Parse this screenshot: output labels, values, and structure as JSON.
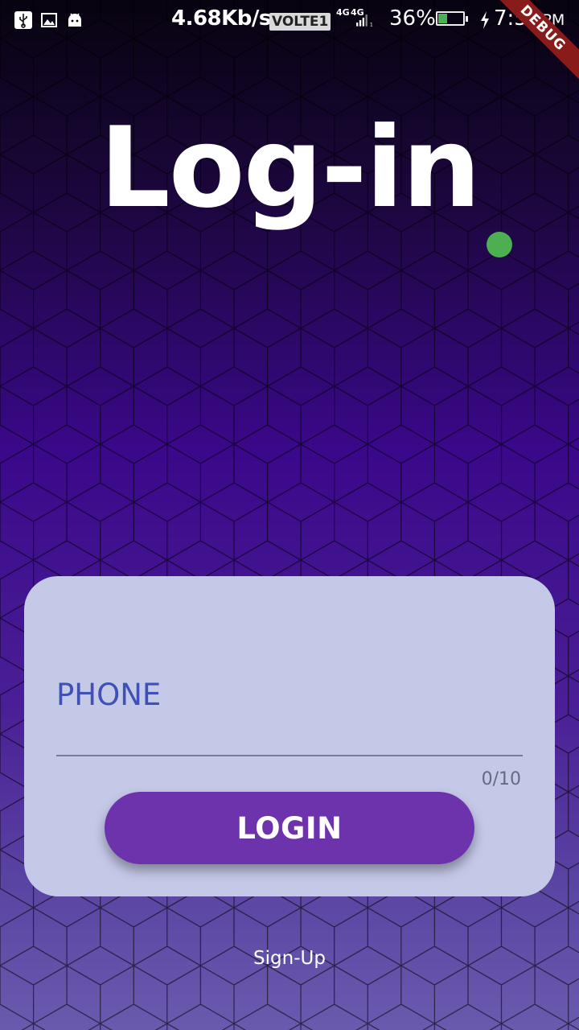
{
  "status_bar": {
    "net_speed": "4.68Kb/s",
    "volte": "VOLTE1",
    "network_a": "4G",
    "network_b": "4G",
    "battery_percent": "36%",
    "battery_level": 0.36,
    "time": "7:54",
    "ampm": "PM",
    "icons": [
      "usb-icon",
      "image-icon",
      "android-icon",
      "signal-icon",
      "charging-icon"
    ]
  },
  "debug_banner": "DEBUG",
  "title": "Log-in",
  "accent_dot_color": "#4caf50",
  "form": {
    "phone_placeholder": "PHONE",
    "phone_value": "",
    "char_counter": "0/10",
    "login_label": "LOGIN"
  },
  "signup_label": "Sign-Up",
  "colors": {
    "card": "#c5c9e8",
    "button": "#6d33ad",
    "input_text": "#3f51b5"
  }
}
